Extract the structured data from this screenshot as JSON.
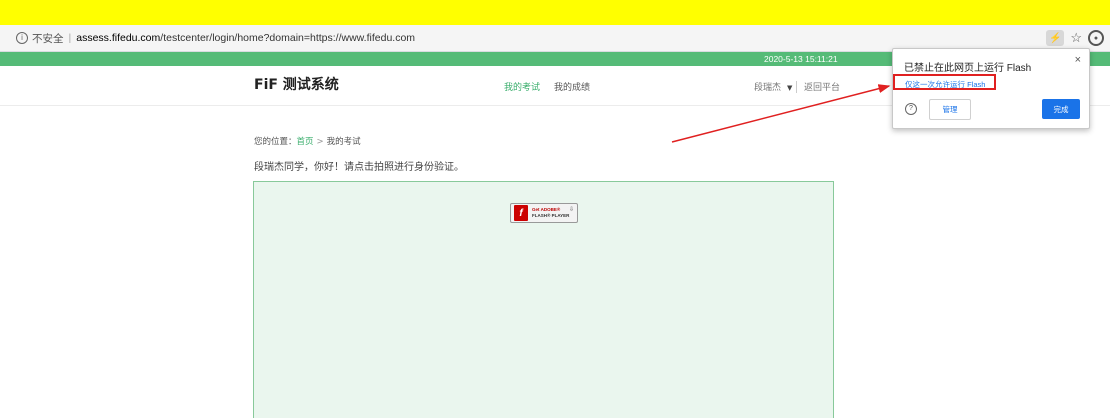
{
  "browser": {
    "security_label": "不安全",
    "url_host": "assess.fifedu.com",
    "url_path": "/testcenter/login/home?domain=https://www.fifedu.com",
    "flash_icon_glyph": "⚡",
    "star_glyph": "☆",
    "profile_glyph": "●"
  },
  "status_bar": {
    "datetime": "2020-5-13 15:11:21",
    "color": "#55bb77"
  },
  "site_header": {
    "logo": "FiF 测试系统",
    "nav_active": "我的考试",
    "nav_scores": "我的成绩",
    "user_name": "段瑞杰",
    "back_label": "返回平台"
  },
  "breadcrumb": {
    "prefix": "您的位置：",
    "home": "首页",
    "separator": ">",
    "current": "我的考试"
  },
  "greeting": "段瑞杰同学，你好！请点击拍照进行身份验证。",
  "flash_placeholder": {
    "badge_line1": "Get ADOBE®",
    "badge_line2": "FLASH® PLAYER",
    "flash_glyph": "f",
    "download_glyph": "⇩"
  },
  "flash_popup": {
    "title": "已禁止在此网页上运行 Flash",
    "allow_once_link": "仅这一次允许运行 Flash",
    "manage_button": "管理",
    "done_button": "完成",
    "close_glyph": "×",
    "help_glyph": "?"
  },
  "colors": {
    "accent_green": "#3aae6c",
    "highlight_red": "#e02020",
    "link_blue": "#1a73e8"
  }
}
